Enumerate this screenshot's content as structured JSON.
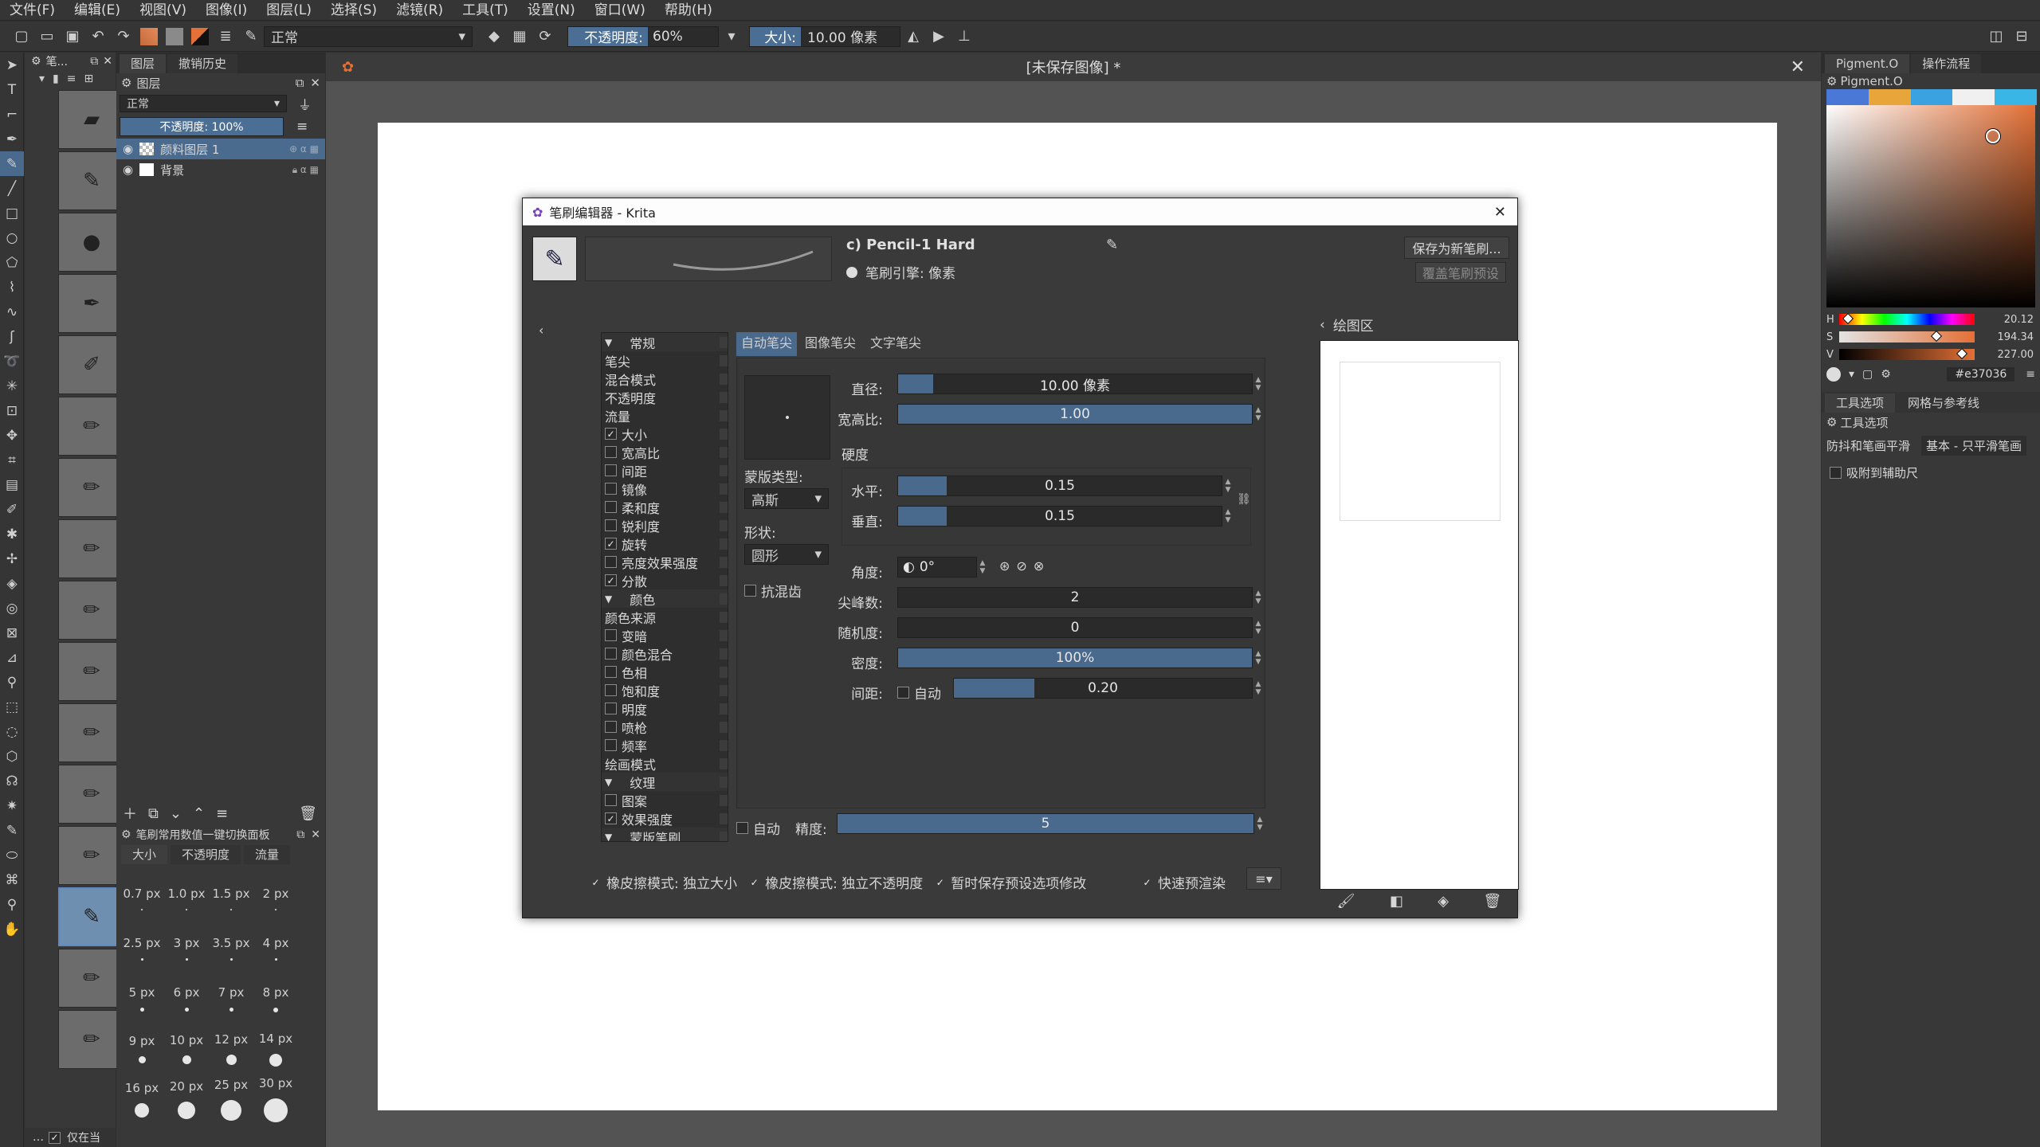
{
  "menu": [
    "文件(F)",
    "编辑(E)",
    "视图(V)",
    "图像(I)",
    "图层(L)",
    "选择(S)",
    "滤镜(R)",
    "工具(T)",
    "设置(N)",
    "窗口(W)",
    "帮助(H)"
  ],
  "toolbar": {
    "blend_mode": "正常",
    "opacity_label": "不透明度:",
    "opacity_value": "60%",
    "size_label": "大小:",
    "size_value": "10.00 像素"
  },
  "canvas": {
    "title": "[未保存图像] *"
  },
  "left_dock": {
    "presets_title": "笔...",
    "layers_tabs": [
      "图层",
      "撤销历史"
    ],
    "layers_header": "图层",
    "blend": "正常",
    "opacity": "不透明度: 100%",
    "layers": [
      {
        "name": "颜料图层 1",
        "selected": true
      },
      {
        "name": "背景",
        "selected": false
      }
    ]
  },
  "size_docker": {
    "title": "笔刷常用数值一键切换面板",
    "tabs": [
      "大小",
      "不透明度",
      "流量"
    ],
    "sizes": [
      "0.7 px",
      "1.0 px",
      "1.5 px",
      "2 px",
      "2.5 px",
      "3 px",
      "3.5 px",
      "4 px",
      "5 px",
      "6 px",
      "7 px",
      "8 px",
      "9 px",
      "10 px",
      "12 px",
      "14 px",
      "16 px",
      "20 px",
      "25 px",
      "30 px"
    ],
    "only_current": "仅在当"
  },
  "right_dock": {
    "tabs": [
      "Pigment.O",
      "操作流程"
    ],
    "panel_title": "Pigment.O",
    "swatches": [
      "#4a78d6",
      "#e8a53a",
      "#3aa2e0",
      "#f0f0f0",
      "#3ab6e6"
    ],
    "color_hex": "#e37036",
    "hsv": [
      {
        "label": "H",
        "value": "20.12"
      },
      {
        "label": "S",
        "value": "194.34"
      },
      {
        "label": "V",
        "value": "227.00"
      }
    ],
    "tool_tabs": [
      "工具选项",
      "网格与参考线"
    ],
    "tool_options_title": "工具选项",
    "smoothing_label": "防抖和笔画平滑",
    "smoothing_value": "基本 - 只平滑笔画",
    "snap_label": "吸附到辅助尺"
  },
  "dialog": {
    "title": "笔刷编辑器 - Krita",
    "preset_name": "c) Pencil-1 Hard",
    "engine": "笔刷引擎: 像素",
    "save_new": "保存为新笔刷...",
    "overwrite": "覆盖笔刷预设",
    "categories": [
      {
        "text": "常规",
        "type": "header"
      },
      {
        "text": "笔尖",
        "type": "plain"
      },
      {
        "text": "混合模式",
        "type": "plain"
      },
      {
        "text": "不透明度",
        "type": "plain"
      },
      {
        "text": "流量",
        "type": "plain"
      },
      {
        "text": "大小",
        "type": "check",
        "checked": true
      },
      {
        "text": "宽高比",
        "type": "check",
        "checked": false
      },
      {
        "text": "间距",
        "type": "check",
        "checked": false
      },
      {
        "text": "镜像",
        "type": "check",
        "checked": false
      },
      {
        "text": "柔和度",
        "type": "check",
        "checked": false
      },
      {
        "text": "锐利度",
        "type": "check",
        "checked": false
      },
      {
        "text": "旋转",
        "type": "check",
        "checked": true
      },
      {
        "text": "亮度效果强度",
        "type": "check",
        "checked": false
      },
      {
        "text": "分散",
        "type": "check",
        "checked": true
      },
      {
        "text": "颜色",
        "type": "header"
      },
      {
        "text": "颜色来源",
        "type": "plain"
      },
      {
        "text": "变暗",
        "type": "check",
        "checked": false
      },
      {
        "text": "颜色混合",
        "type": "check",
        "checked": false
      },
      {
        "text": "色相",
        "type": "check",
        "checked": false
      },
      {
        "text": "饱和度",
        "type": "check",
        "checked": false
      },
      {
        "text": "明度",
        "type": "check",
        "checked": false
      },
      {
        "text": "喷枪",
        "type": "check",
        "checked": false
      },
      {
        "text": "频率",
        "type": "check",
        "checked": false
      },
      {
        "text": "绘画模式",
        "type": "plain"
      },
      {
        "text": "纹理",
        "type": "header"
      },
      {
        "text": "图案",
        "type": "check",
        "checked": false
      },
      {
        "text": "效果强度",
        "type": "check",
        "checked": true
      },
      {
        "text": "蒙版笔刷",
        "type": "header"
      }
    ],
    "tip_tabs": [
      "自动笔尖",
      "图像笔尖",
      "文字笔尖"
    ],
    "diameter_label": "直径:",
    "diameter_value": "10.00 像素",
    "diameter_fill": 0.1,
    "ratio_label": "宽高比:",
    "ratio_value": "1.00",
    "ratio_fill": 1.0,
    "mask_type_label": "蒙版类型:",
    "mask_type": "高斯",
    "shape_label": "形状:",
    "shape": "圆形",
    "antialias": "抗混齿",
    "hardness_label": "硬度",
    "horizontal_label": "水平:",
    "horizontal_value": "0.15",
    "horizontal_fill": 0.15,
    "vertical_label": "垂直:",
    "vertical_value": "0.15",
    "vertical_fill": 0.15,
    "angle_label": "角度:",
    "angle_value": "0°",
    "spikes_label": "尖峰数:",
    "spikes_value": "2",
    "random_label": "随机度:",
    "random_value": "0",
    "density_label": "密度:",
    "density_value": "100%",
    "density_fill": 1.0,
    "spacing_label": "间距:",
    "spacing_auto": "自动",
    "spacing_value": "0.20",
    "spacing_fill": 0.27,
    "precision_auto": "自动",
    "precision_label": "精度:",
    "precision_value": "5",
    "eraser_size": "橡皮擦模式: 独立大小",
    "eraser_opacity": "橡皮擦模式: 独立不透明度",
    "temp_save": "暂时保存预设选项修改",
    "fast_preview": "快速预渲染",
    "scratchpad_title": "绘图区"
  }
}
